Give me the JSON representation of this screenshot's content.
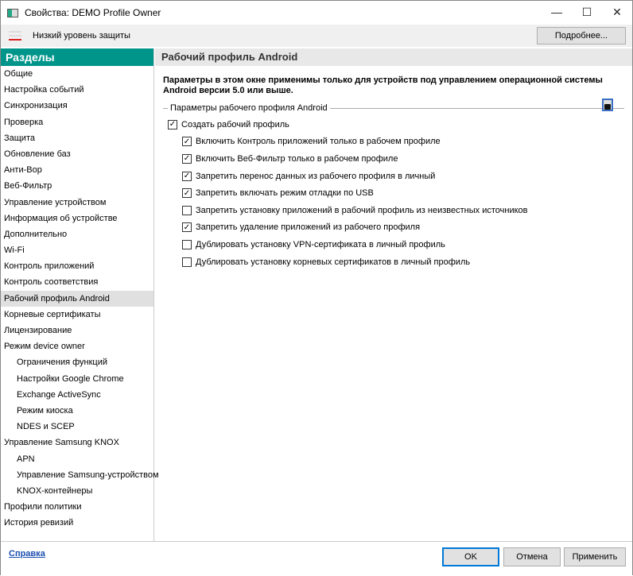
{
  "window": {
    "title": "Свойства: DEMO Profile Owner",
    "controls": [
      "—",
      "☐",
      "✕"
    ]
  },
  "toolbar": {
    "protection_level": "Низкий уровень защиты",
    "more_button": "Подробнее..."
  },
  "sidebar": {
    "header": "Разделы",
    "items": [
      {
        "label": "Общие"
      },
      {
        "label": "Настройка событий"
      },
      {
        "label": "Синхронизация"
      },
      {
        "label": "Проверка"
      },
      {
        "label": "Защита"
      },
      {
        "label": "Обновление баз"
      },
      {
        "label": "Анти-Вор"
      },
      {
        "label": "Веб-Фильтр"
      },
      {
        "label": "Управление устройством"
      },
      {
        "label": "Информация об устройстве"
      },
      {
        "label": "Дополнительно"
      },
      {
        "label": "Wi-Fi"
      },
      {
        "label": "Контроль приложений"
      },
      {
        "label": "Контроль соответствия"
      },
      {
        "label": "Рабочий профиль Android",
        "selected": true
      },
      {
        "label": "Корневые сертификаты"
      },
      {
        "label": "Лицензирование"
      },
      {
        "label": "Режим device owner"
      },
      {
        "label": "Ограничения функций",
        "sub": true
      },
      {
        "label": "Настройки Google Chrome",
        "sub": true
      },
      {
        "label": "Exchange ActiveSync",
        "sub": true
      },
      {
        "label": "Режим киоска",
        "sub": true
      },
      {
        "label": "NDES и SCEP",
        "sub": true
      },
      {
        "label": "Управление Samsung KNOX"
      },
      {
        "label": "APN",
        "sub": true
      },
      {
        "label": "Управление Samsung-устройством",
        "sub": true
      },
      {
        "label": "KNOX-контейнеры",
        "sub": true
      },
      {
        "label": "Профили политики"
      },
      {
        "label": "История ревизий"
      }
    ]
  },
  "main": {
    "title": "Рабочий профиль Android",
    "note": "Параметры в этом окне применимы только для устройств под управлением операционной системы Android версии 5.0 или выше.",
    "group_label": "Параметры рабочего профиля Android",
    "lock_state": "locked",
    "create_profile": {
      "label": "Создать рабочий профиль",
      "checked": true
    },
    "options": [
      {
        "label": "Включить Контроль приложений только в рабочем профиле",
        "checked": true
      },
      {
        "label": "Включить Веб-Фильтр только в рабочем профиле",
        "checked": true
      },
      {
        "label": "Запретить перенос данных из рабочего профиля в личный",
        "checked": true
      },
      {
        "label": "Запретить включать режим отладки по USB",
        "checked": true
      },
      {
        "label": "Запретить установку приложений в рабочий профиль из неизвестных источников",
        "checked": false
      },
      {
        "label": "Запретить удаление приложений из рабочего профиля",
        "checked": true
      },
      {
        "label": "Дублировать установку VPN-сертификата в личный профиль",
        "checked": false
      },
      {
        "label": "Дублировать установку корневых сертификатов в личный профиль",
        "checked": false
      }
    ]
  },
  "footer": {
    "help": "Справка",
    "ok": "OK",
    "cancel": "Отмена",
    "apply": "Применить"
  }
}
